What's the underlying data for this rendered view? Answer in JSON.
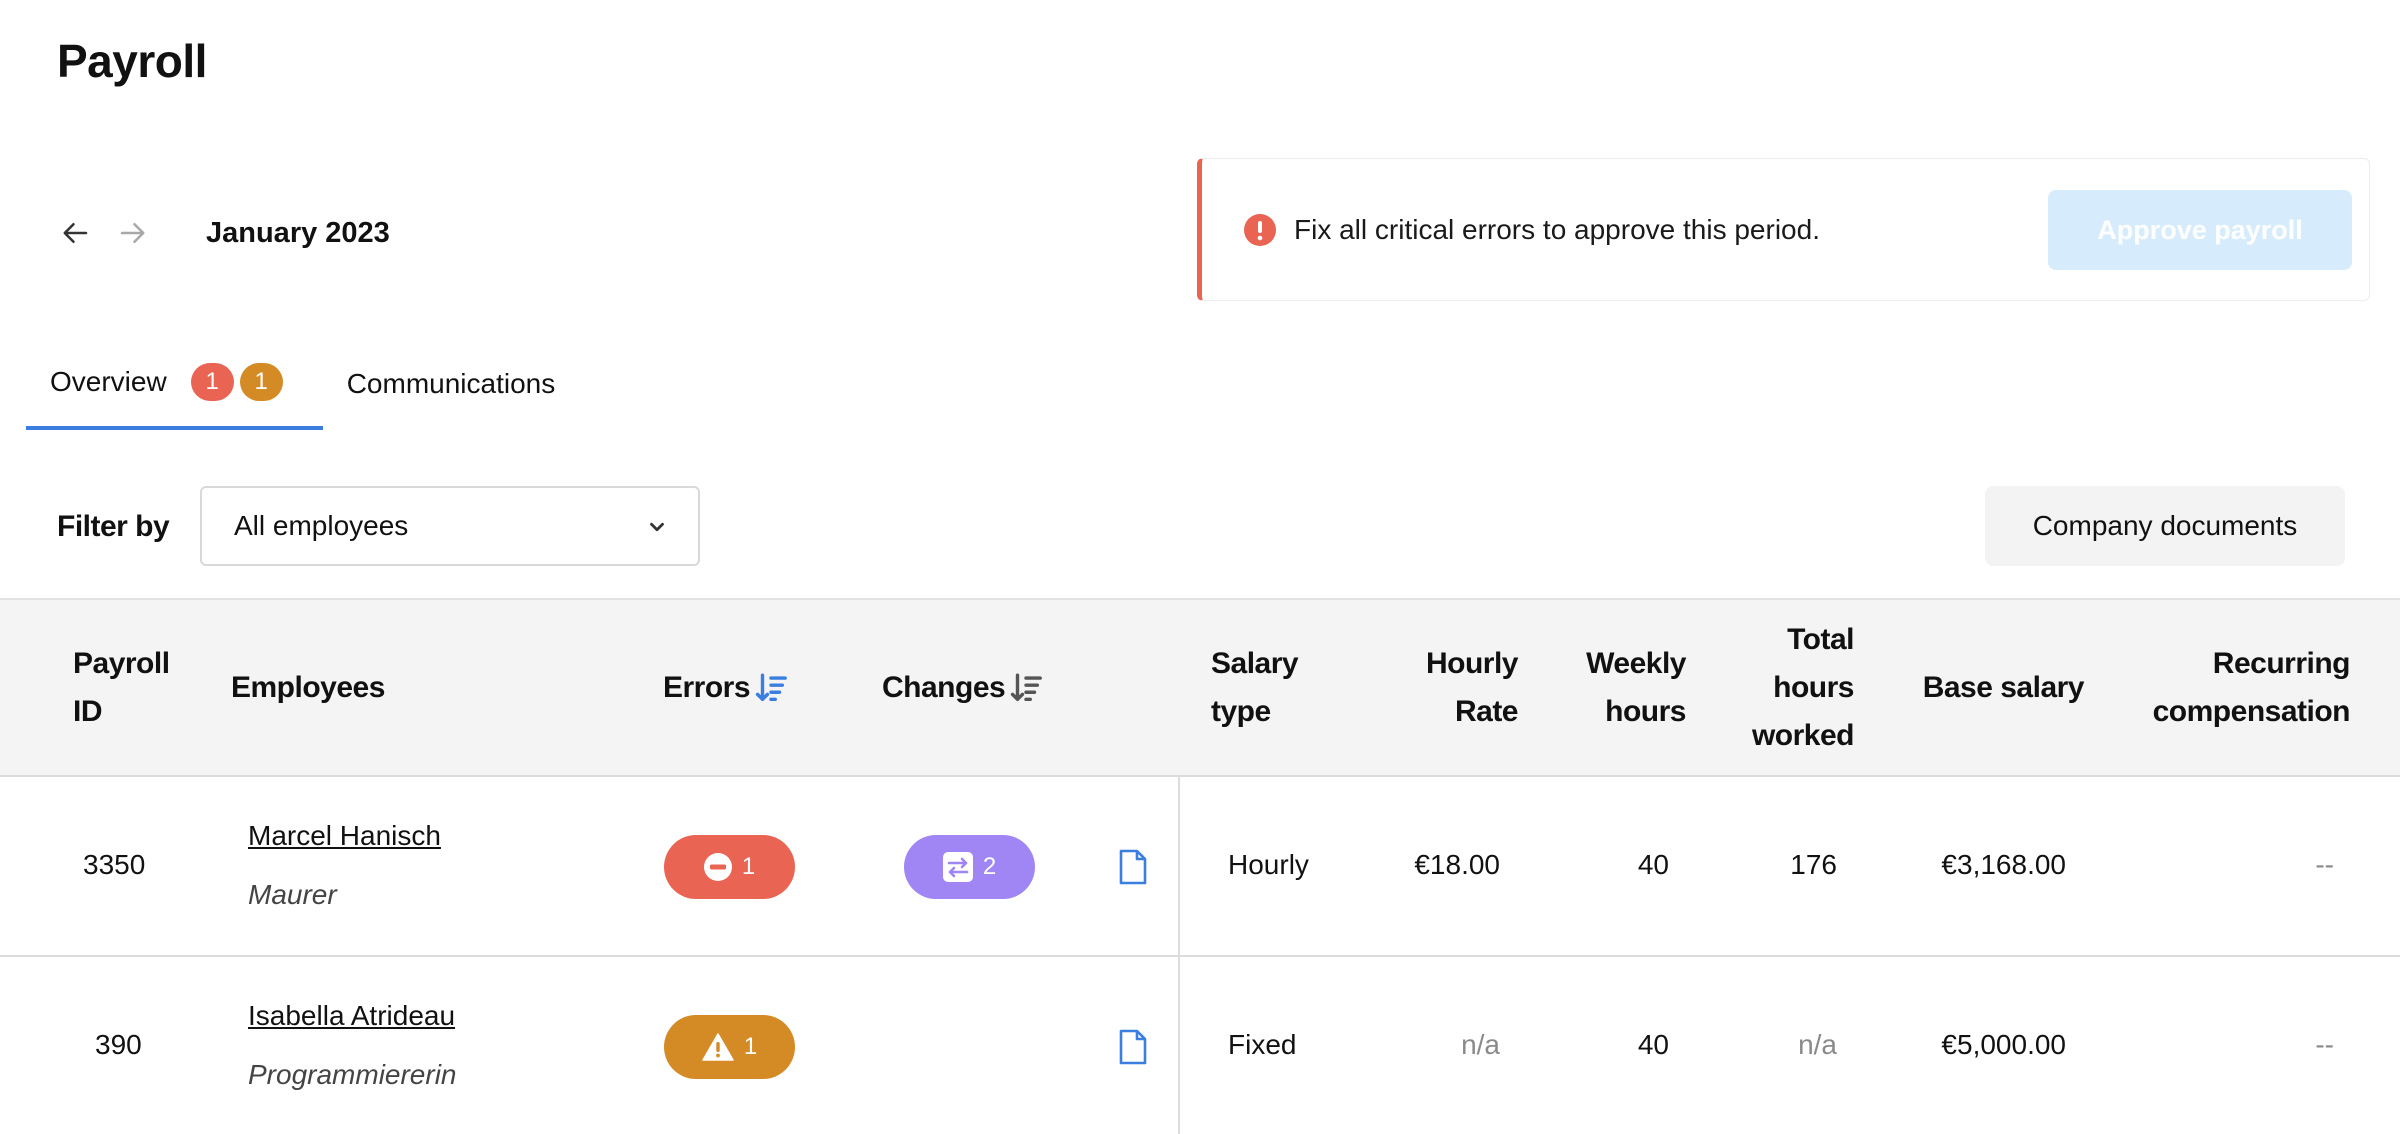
{
  "page": {
    "title": "Payroll"
  },
  "period": {
    "label": "January 2023"
  },
  "banner": {
    "message": "Fix all critical errors to approve this period.",
    "approve_label": "Approve payroll"
  },
  "tabs": [
    {
      "label": "Overview",
      "badges": [
        "1",
        "1"
      ]
    },
    {
      "label": "Communications"
    }
  ],
  "filter": {
    "label": "Filter by",
    "selected": "All employees"
  },
  "company_docs_label": "Company documents",
  "table": {
    "headers": {
      "payroll_id": "Payroll ID",
      "employees": "Employees",
      "errors": "Errors",
      "changes": "Changes",
      "salary_type": "Salary type",
      "hourly_rate": "Hourly Rate",
      "weekly_hours": "Weekly hours",
      "total_hours": "Total hours worked",
      "base_salary": "Base salary",
      "recurring": "Recurring compensation"
    },
    "rows": [
      {
        "id": "3350",
        "name": "Marcel Hanisch",
        "role": "Maurer",
        "errors": "1",
        "error_kind": "critical",
        "changes": "2",
        "salary_type": "Hourly",
        "hourly_rate": "€18.00",
        "weekly_hours": "40",
        "total_hours": "176",
        "base_salary": "€3,168.00",
        "recurring": "--"
      },
      {
        "id": "390",
        "name": "Isabella Atrideau",
        "role": "Programmiererin",
        "errors": "1",
        "error_kind": "warning",
        "changes": "",
        "salary_type": "Fixed",
        "hourly_rate": "n/a",
        "weekly_hours": "40",
        "total_hours": "n/a",
        "base_salary": "€5,000.00",
        "recurring": "--"
      }
    ]
  },
  "colors": {
    "critical": "#ea6454",
    "warning": "#d48a25",
    "change": "#9f86f4",
    "accent": "#3a7ee0",
    "approve_disabled": "#d6ecfc"
  }
}
